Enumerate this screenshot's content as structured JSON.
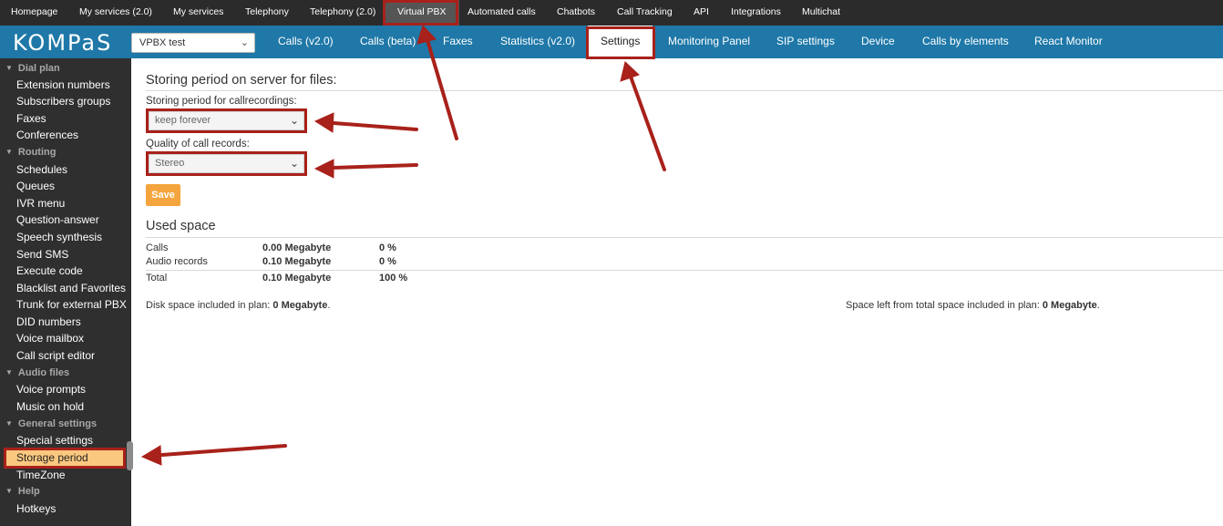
{
  "topnav": {
    "items": [
      {
        "label": "Homepage"
      },
      {
        "label": "My services (2.0)"
      },
      {
        "label": "My services"
      },
      {
        "label": "Telephony"
      },
      {
        "label": "Telephony (2.0)"
      },
      {
        "label": "Virtual PBX"
      },
      {
        "label": "Automated calls"
      },
      {
        "label": "Chatbots"
      },
      {
        "label": "Call Tracking"
      },
      {
        "label": "API"
      },
      {
        "label": "Integrations"
      },
      {
        "label": "Multichat"
      }
    ],
    "active": "Virtual PBX"
  },
  "brand": {
    "logo_text": "KOMPaS"
  },
  "vpbx_select": {
    "value": "VPBX test"
  },
  "tabs": [
    {
      "label": "Calls (v2.0)"
    },
    {
      "label": "Calls (beta)"
    },
    {
      "label": "Faxes"
    },
    {
      "label": "Statistics (v2.0)"
    },
    {
      "label": "Settings"
    },
    {
      "label": "Monitoring Panel"
    },
    {
      "label": "SIP settings"
    },
    {
      "label": "Device"
    },
    {
      "label": "Calls by elements"
    },
    {
      "label": "React Monitor"
    }
  ],
  "active_tab": "Settings",
  "sidebar": {
    "groups": [
      {
        "label": "Dial plan",
        "items": [
          "Extension numbers",
          "Subscribers groups",
          "Faxes",
          "Conferences"
        ]
      },
      {
        "label": "Routing",
        "items": [
          "Schedules",
          "Queues",
          "IVR menu",
          "Question-answer",
          "Speech synthesis",
          "Send SMS",
          "Execute code",
          "Blacklist and Favorites",
          "Trunk for external PBX",
          "DID numbers",
          "Voice mailbox",
          "Call script editor"
        ]
      },
      {
        "label": "Audio files",
        "items": [
          "Voice prompts",
          "Music on hold"
        ]
      },
      {
        "label": "General settings",
        "items": [
          "Special settings",
          "Storage period",
          "TimeZone"
        ]
      },
      {
        "label": "Help",
        "items": [
          "Hotkeys"
        ]
      }
    ],
    "active_item": "Storage period"
  },
  "storage": {
    "title": "Storing period on server for files:",
    "recordings_label": "Storing period for callrecordings:",
    "recordings_value": "keep forever",
    "quality_label": "Quality of call records:",
    "quality_value": "Stereo",
    "save_label": "Save"
  },
  "used_space": {
    "title": "Used space",
    "rows": [
      {
        "name": "Calls",
        "size": "0.00 Megabyte",
        "percent": "0 %"
      },
      {
        "name": "Audio records",
        "size": "0.10 Megabyte",
        "percent": "0 %"
      },
      {
        "name": "Total",
        "size": "0.10 Megabyte",
        "percent": "100 %"
      }
    ],
    "disk_label": "Disk space included in plan:",
    "disk_value": "0 Megabyte",
    "left_label": "Space left from total space included in plan:",
    "left_value": "0 Megabyte"
  },
  "colors": {
    "top_nav_bg": "#2b2b2b",
    "blue_bar": "#1f78a8",
    "sidebar_bg": "#2f2f2f",
    "active_sidebar": "#fbc87f",
    "save_button": "#f4a53d",
    "annotation_red": "#a8211a"
  }
}
